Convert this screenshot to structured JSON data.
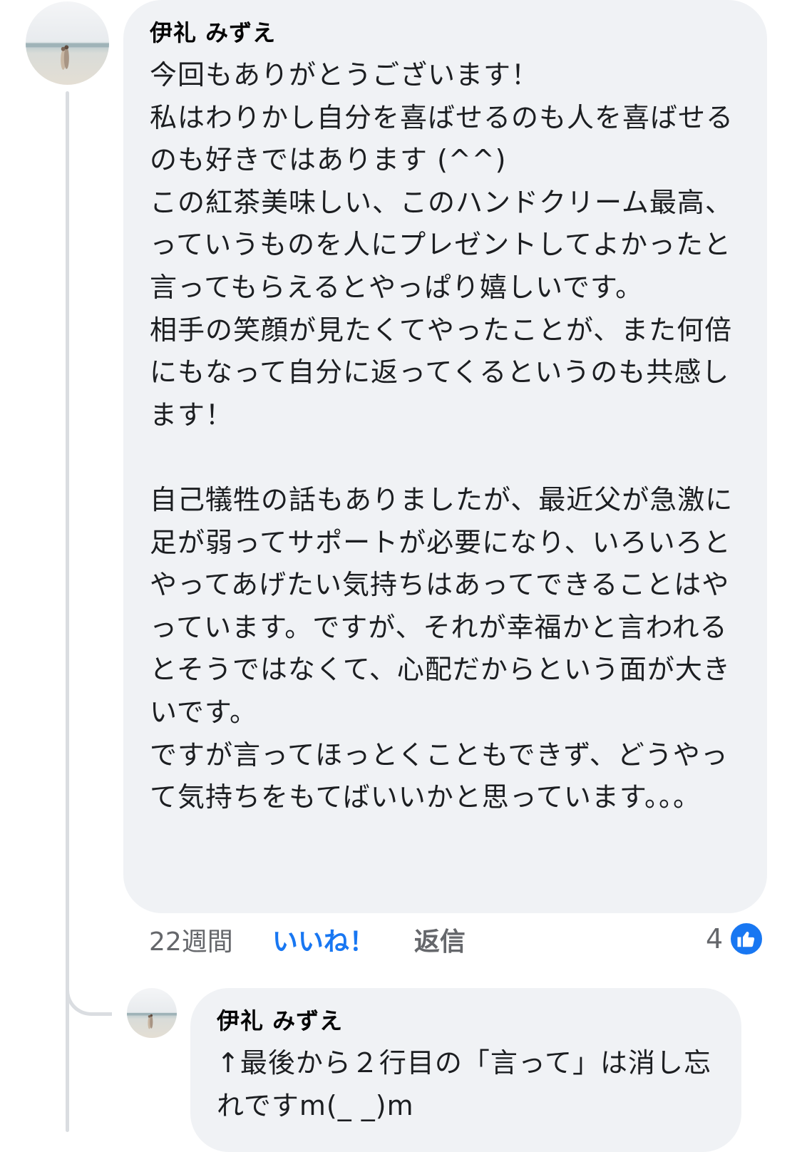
{
  "comment": {
    "author": "伊礼 みずえ",
    "lines": [
      "今回もありがとうございます！",
      "私はわりかし自分を喜ばせるのも人を喜ばせるのも好きではあります (^^)",
      "この紅茶美味しい、このハンドクリーム最高、っていうものを人にプレゼントしてよかったと言ってもらえるとやっぱり嬉しいです。",
      "相手の笑顔が見たくてやったことが、また何倍にもなって自分に返ってくるというのも共感します！",
      "",
      "自己犠牲の話もありましたが、最近父が急激に足が弱ってサポートが必要になり、いろいろとやってあげたい気持ちはあってできることはやっています。ですが、それが幸福かと言われるとそうではなくて、心配だからという面が大きいです。",
      "ですが言ってほっとくこともできず、どうやって気持ちをもてばいいかと思っています。。。"
    ],
    "time": "22週間",
    "like_label": "いいね！",
    "reply_label": "返信",
    "reaction_count": "4",
    "reaction_icon": "thumbs-up-icon",
    "accent_color": "#1877f2"
  },
  "reply": {
    "author": "伊礼 みずえ",
    "text": "↑最後から２行目の「言って」は消し忘れですm(_ _)m"
  }
}
